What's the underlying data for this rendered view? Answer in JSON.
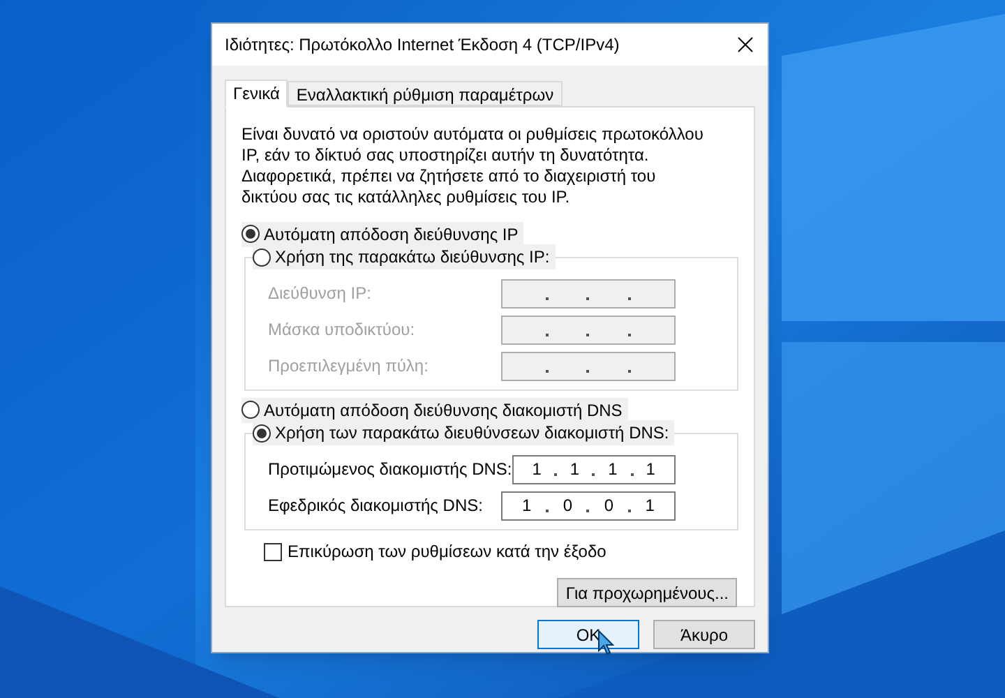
{
  "window": {
    "title": "Ιδιότητες: Πρωτόκολλο Internet Έκδοση 4 (TCP/IPv4)"
  },
  "tabs": [
    {
      "label": "Γενικά",
      "selected": true
    },
    {
      "label": "Εναλλακτική ρύθμιση παραμέτρων",
      "selected": false
    }
  ],
  "intro": "Είναι δυνατό να οριστούν αυτόματα οι ρυθμίσεις πρωτοκόλλου IP, εάν το δίκτυό σας υποστηρίζει αυτήν τη δυνατότητα. Διαφορετικά, πρέπει να ζητήσετε από το διαχειριστή του δικτύου σας τις κατάλληλες ρυθμίσεις του IP.",
  "ip_section": {
    "auto_option": {
      "label": "Αυτόματη απόδοση διεύθυνσης IP",
      "selected": true
    },
    "manual_option": {
      "label": "Χρήση της παρακάτω διεύθυνσης IP:",
      "selected": false
    },
    "fields": [
      {
        "label": "Διεύθυνση IP:",
        "disabled": true
      },
      {
        "label": "Μάσκα υποδικτύου:",
        "disabled": true
      },
      {
        "label": "Προεπιλεγμένη πύλη:",
        "disabled": true
      }
    ]
  },
  "dns_section": {
    "auto_option": {
      "label": "Αυτόματη απόδοση διεύθυνσης διακομιστή DNS",
      "selected": false
    },
    "manual_option": {
      "label": "Χρήση των παρακάτω διευθύνσεων διακομιστή DNS:",
      "selected": true
    },
    "fields": [
      {
        "label": "Προτιμώμενος διακομιστής DNS:",
        "disabled": false,
        "octets": [
          "1",
          "1",
          "1",
          "1"
        ]
      },
      {
        "label": "Εφεδρικός διακομιστής DNS:",
        "disabled": false,
        "octets": [
          "1",
          "0",
          "0",
          "1"
        ]
      }
    ]
  },
  "validate_on_exit": {
    "label": "Επικύρωση των ρυθμίσεων κατά την έξοδο",
    "checked": false
  },
  "advanced_button": "Για προχωρημένους...",
  "buttons": [
    {
      "label": "OK",
      "focused": true
    },
    {
      "label": "Άκυρο",
      "focused": false
    }
  ]
}
